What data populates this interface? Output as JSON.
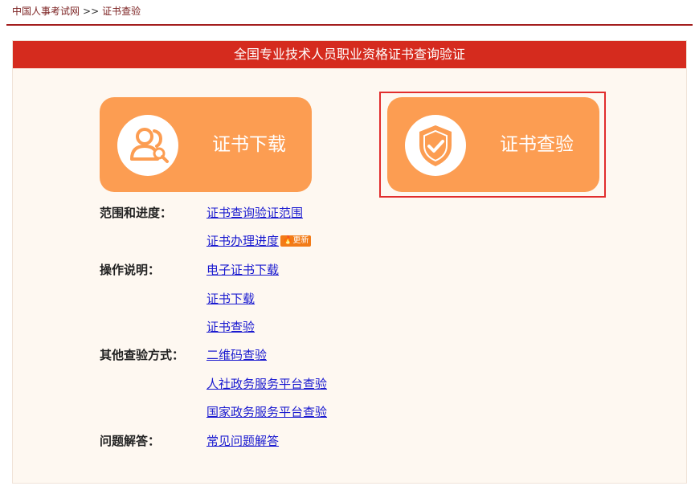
{
  "breadcrumb": {
    "home": "中国人事考试网",
    "separator": ">>",
    "current": "证书查验"
  },
  "panel": {
    "title": "全国专业技术人员职业资格证书查询验证"
  },
  "buttons": {
    "download": {
      "label": "证书下载",
      "icon": "user-search-icon"
    },
    "verify": {
      "label": "证书查验",
      "icon": "shield-check-icon"
    }
  },
  "sections": {
    "scope": {
      "label": "范围和进度：",
      "links": [
        "证书查询验证范围",
        "证书办理进度"
      ],
      "badge": "更新"
    },
    "instructions": {
      "label": "操作说明：",
      "links": [
        "电子证书下载",
        "证书下载",
        "证书查验"
      ]
    },
    "other": {
      "label": "其他查验方式：",
      "links": [
        "二维码查验",
        "人社政务服务平台查验",
        "国家政务服务平台查验"
      ]
    },
    "faq": {
      "label": "问题解答：",
      "links": [
        "常见问题解答"
      ]
    }
  },
  "colors": {
    "header": "#d52b1e",
    "button": "#fc9d52",
    "highlight": "#e12d2d",
    "link": "#1a1ad0"
  }
}
